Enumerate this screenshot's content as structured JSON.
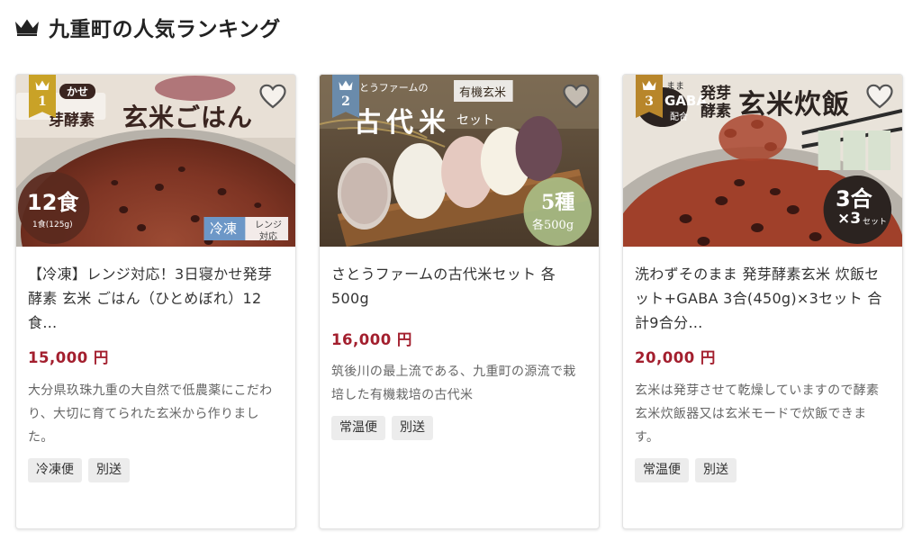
{
  "header": {
    "title": "九重町の人気ランキング",
    "icon": "crown-icon"
  },
  "colors": {
    "price": "#a31f2e",
    "rank_1": "#c9a227",
    "rank_2": "#6a8bab",
    "rank_3": "#b8862b",
    "tag_bg": "#ececec"
  },
  "products": [
    {
      "rank": "1",
      "title": "【冷凍】レンジ対応！3日寝かせ発芽 酵素 玄米 ごはん（ひとめぼれ）12食…",
      "price": "15,000 円",
      "description": "大分県玖珠九重の大自然で低農薬にこだわり、大切に育てられた玄米から作りました。",
      "tags": [
        "冷凍便",
        "別送"
      ],
      "image_text": {
        "top_small": "かせ",
        "brand": "芽酵素",
        "headline": "玄米ごはん",
        "count": "12食",
        "count_sub": "1食(125g)",
        "frozen": "冷凍",
        "range": "レンジ",
        "range_sub": "対応"
      }
    },
    {
      "rank": "2",
      "title": "さとうファームの古代米セット 各500g",
      "price": "16,000 円",
      "description": "筑後川の最上流である、九重町の源流で栽培した有機栽培の古代米",
      "tags": [
        "常温便",
        "別送"
      ],
      "image_text": {
        "farm": "とうファームの",
        "organic": "有機玄米",
        "headline": "古代米",
        "set": "セット",
        "kinds": "5種",
        "weight": "各500g"
      }
    },
    {
      "rank": "3",
      "title": "洗わずそのまま 発芽酵素玄米 炊飯セット+GABA 3合(450g)×3セット 合計9合分…",
      "price": "20,000 円",
      "description": "玄米は発芽させて乾燥していますので酵素玄米炊飯器又は玄米モードで炊飯できます。",
      "tags": [
        "常温便",
        "別送"
      ],
      "image_text": {
        "top_small": "まま",
        "gaba": "GABA",
        "gaba_sub": "配合",
        "line1": "発芽",
        "line2": "酵素",
        "headline": "玄米炊飯",
        "go": "3合",
        "set": "×3",
        "set_sub": "セット"
      }
    }
  ]
}
